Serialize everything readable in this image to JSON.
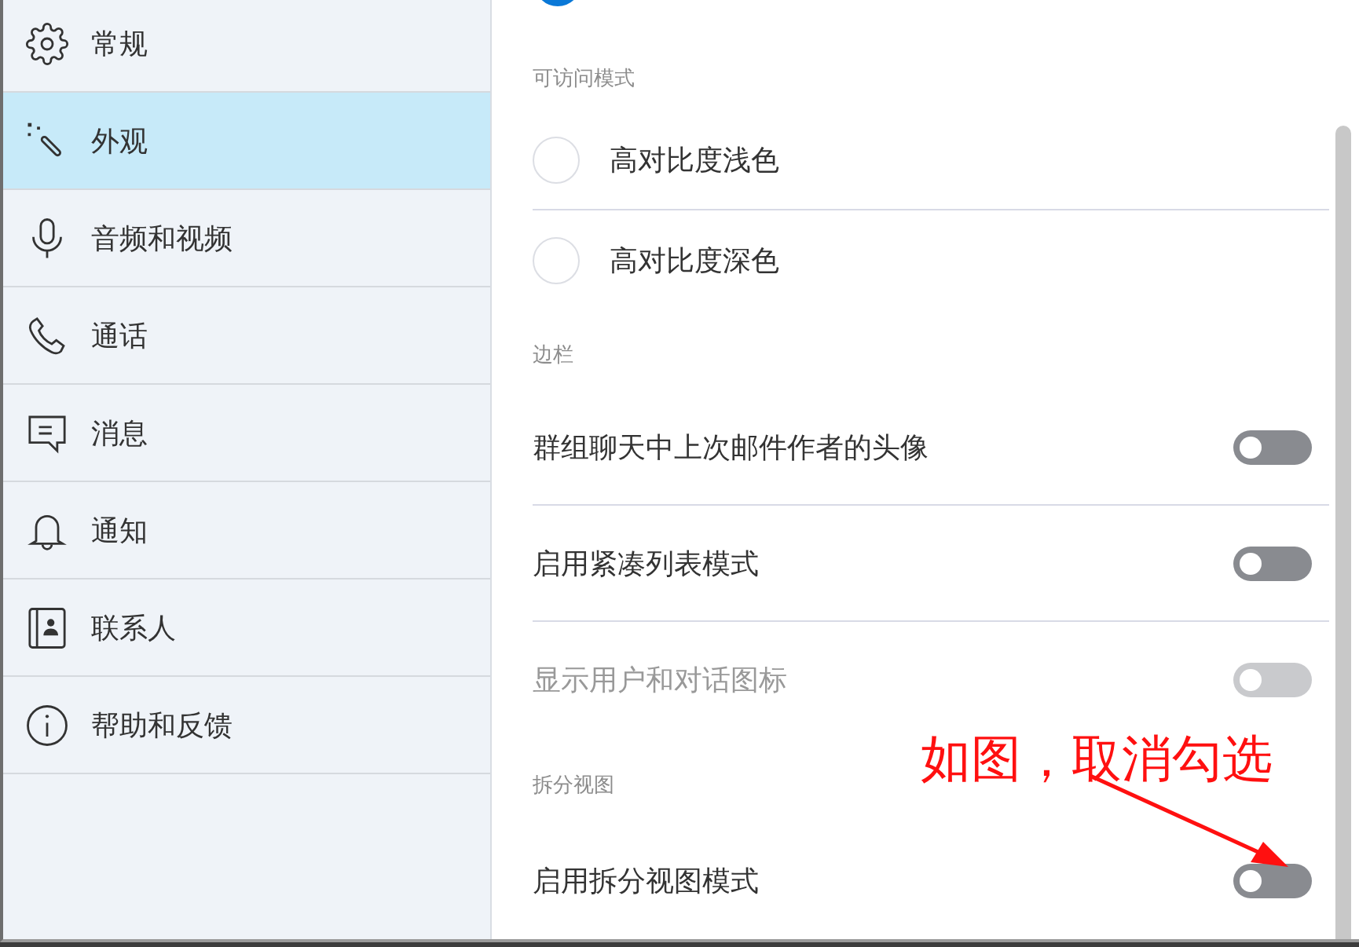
{
  "sidebar": {
    "items": [
      {
        "label": "常规",
        "selected": false
      },
      {
        "label": "外观",
        "selected": true
      },
      {
        "label": "音频和视频",
        "selected": false
      },
      {
        "label": "通话",
        "selected": false
      },
      {
        "label": "消息",
        "selected": false
      },
      {
        "label": "通知",
        "selected": false
      },
      {
        "label": "联系人",
        "selected": false
      },
      {
        "label": "帮助和反馈",
        "selected": false
      }
    ]
  },
  "settings": {
    "partial_option": {
      "kind": "radio",
      "selected": true
    },
    "sections": [
      {
        "title": "可访问模式",
        "rows": [
          {
            "kind": "radio",
            "label": "高对比度浅色",
            "selected": false
          },
          {
            "kind": "radio",
            "label": "高对比度深色",
            "selected": false
          }
        ]
      },
      {
        "title": "边栏",
        "rows": [
          {
            "kind": "toggle",
            "label": "群组聊天中上次邮件作者的头像",
            "on": false,
            "disabled": false
          },
          {
            "kind": "toggle",
            "label": "启用紧凑列表模式",
            "on": false,
            "disabled": false
          },
          {
            "kind": "toggle",
            "label": "显示用户和对话图标",
            "on": false,
            "disabled": true
          }
        ]
      },
      {
        "title": "拆分视图",
        "rows": [
          {
            "kind": "toggle",
            "label": "启用拆分视图模式",
            "on": false,
            "disabled": false
          }
        ]
      }
    ]
  },
  "annotation": {
    "text": "如图，取消勾选"
  }
}
